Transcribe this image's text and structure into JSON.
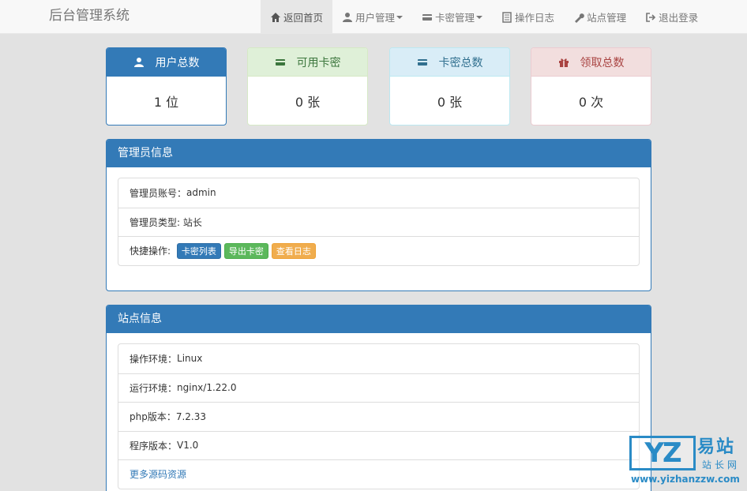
{
  "brand": "后台管理系统",
  "nav": [
    {
      "label": "返回首页",
      "icon": "home-icon",
      "active": true
    },
    {
      "label": "用户管理",
      "icon": "user-icon",
      "dropdown": true
    },
    {
      "label": "卡密管理",
      "icon": "card-icon",
      "dropdown": true
    },
    {
      "label": "操作日志",
      "icon": "list-icon"
    },
    {
      "label": "站点管理",
      "icon": "wrench-icon"
    },
    {
      "label": "退出登录",
      "icon": "logout-icon"
    }
  ],
  "stats": [
    {
      "title": "用户总数",
      "value": "1 位",
      "icon": "user-icon"
    },
    {
      "title": "可用卡密",
      "value": "0 张",
      "icon": "card-icon"
    },
    {
      "title": "卡密总数",
      "value": "0 张",
      "icon": "card-icon"
    },
    {
      "title": "领取总数",
      "value": "0 次",
      "icon": "gift-icon"
    }
  ],
  "admin_panel": {
    "title": "管理员信息",
    "account_label": "管理员账号：",
    "account_value": "admin",
    "type_label": "管理员类型: ",
    "type_value": "站长",
    "quick_label": "快捷操作: ",
    "buttons": [
      "卡密列表",
      "导出卡密",
      "查看日志"
    ]
  },
  "site_panel": {
    "title": "站点信息",
    "rows": [
      {
        "label": "操作环境：",
        "value": "Linux"
      },
      {
        "label": "运行环境：",
        "value": "nginx/1.22.0"
      },
      {
        "label": "php版本：",
        "value": "7.2.33"
      },
      {
        "label": "程序版本：",
        "value": "V1.0"
      }
    ],
    "more_link": "更多源码资源"
  },
  "watermark": {
    "logo": "YZ",
    "big": "易站",
    "small": "站长网",
    "url": "www.yizhanzzw.com"
  },
  "colors": {
    "primary": "#337ab7",
    "success": "#5cb85c",
    "warning": "#f0ad4e"
  }
}
